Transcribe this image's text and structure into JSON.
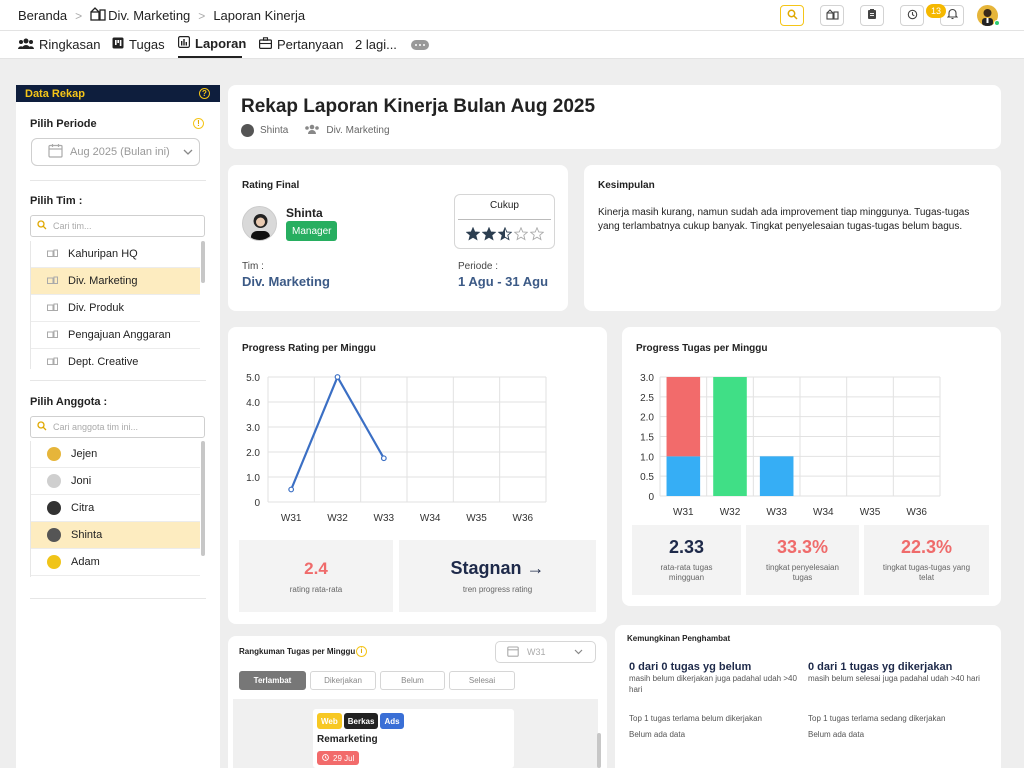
{
  "breadcrumbs": [
    "Beranda",
    "Div. Marketing",
    "Laporan Kinerja"
  ],
  "notif_count": "13",
  "tabs": [
    {
      "label": "Ringkasan"
    },
    {
      "label": "Tugas"
    },
    {
      "label": "Laporan"
    },
    {
      "label": "Pertanyaan"
    },
    {
      "label": "2 lagi..."
    }
  ],
  "sidebar": {
    "header": "Data Rekap",
    "period_label": "Pilih Periode",
    "period_value": "Aug 2025 (Bulan ini)",
    "team_label": "Pilih Tim :",
    "team_search_placeholder": "Cari tim...",
    "teams": [
      "Kahuripan HQ",
      "Div. Marketing",
      "Div. Produk",
      "Pengajuan Anggaran",
      "Dept. Creative"
    ],
    "member_label": "Pilih Anggota :",
    "member_search_placeholder": "Cari anggota tim ini...",
    "members": [
      "Jejen",
      "Joni",
      "Citra",
      "Shinta",
      "Adam"
    ]
  },
  "report": {
    "title": "Rekap Laporan Kinerja Bulan Aug 2025",
    "person": "Shinta",
    "team": "Div. Marketing"
  },
  "rating": {
    "title": "Rating Final",
    "name": "Shinta",
    "role": "Manager",
    "label": "Cukup",
    "stars": 2.5,
    "team_label": "Tim :",
    "team_value": "Div. Marketing",
    "period_label": "Periode :",
    "period_value": "1 Agu - 31 Agu"
  },
  "conclusion": {
    "title": "Kesimpulan",
    "text": "Kinerja masih kurang, namun sudah ada improvement tiap minggunya. Tugas-tugas yang terlambatnya cukup banyak. Tingkat penyelesaian tugas-tugas belum bagus."
  },
  "rating_chart": {
    "title": "Progress Rating per Minggu",
    "avg_value": "2.4",
    "avg_label": "rating rata-rata",
    "trend_value": "Stagnan →",
    "trend_label": "tren progress rating"
  },
  "task_chart": {
    "title": "Progress Tugas per Minggu",
    "stats": [
      {
        "value": "2.33",
        "label": "rata-rata tugas mingguan",
        "color": "#1e2a4a"
      },
      {
        "value": "33.3%",
        "label": "tingkat penyelesaian tugas",
        "color": "#ef6b6b"
      },
      {
        "value": "22.3%",
        "label": "tingkat tugas-tugas yang telat",
        "color": "#ef6b6b"
      }
    ]
  },
  "summary": {
    "title": "Rangkuman Tugas per Minggu",
    "week": "W31",
    "filters": [
      "Terlambat",
      "Dikerjakan",
      "Belum",
      "Selesai"
    ],
    "task": {
      "tags": [
        "Web",
        "Berkas",
        "Ads"
      ],
      "title": "Remarketing",
      "date": "29 Jul"
    }
  },
  "blockers": {
    "title": "Kemungkinan Penghambat",
    "cols": [
      {
        "head": "0 dari 0 tugas yg belum",
        "sub": "masih belum dikerjakan juga padahal udah >40 hari",
        "top": "Top 1 tugas terlama belum dikerjakan",
        "none": "Belum ada data"
      },
      {
        "head": "0 dari 1 tugas yg dikerjakan",
        "sub": "masih belum selesai juga padahal udah >40 hari",
        "top": "Top 1 tugas terlama sedang dikerjakan",
        "none": "Belum ada data"
      }
    ]
  },
  "chart_data": [
    {
      "type": "line",
      "x": [
        "W31",
        "W32",
        "W33",
        "W34",
        "W35",
        "W36"
      ],
      "values": [
        0.5,
        5,
        1.75,
        null,
        null,
        null
      ],
      "ylim": [
        0,
        5
      ],
      "yticks": [
        "0",
        "1.0",
        "2.0",
        "3.0",
        "4.0",
        "5.0"
      ],
      "color": "#3b6fc4"
    },
    {
      "type": "bar",
      "categories": [
        "W31",
        "W32",
        "W33",
        "W34",
        "W35",
        "W36"
      ],
      "series": [
        {
          "values": [
            1,
            0,
            1,
            0,
            0,
            0
          ],
          "color": "#36aef5"
        },
        {
          "values": [
            0,
            3,
            0,
            0,
            0,
            0
          ],
          "color": "#40df86"
        },
        {
          "values": [
            2,
            0,
            0,
            0,
            0,
            0
          ],
          "color": "#f26b6b"
        }
      ],
      "ylim": [
        0,
        3
      ],
      "yticks": [
        "0",
        "0.5",
        "1.0",
        "1.5",
        "2.0",
        "2.5",
        "3.0"
      ]
    }
  ]
}
